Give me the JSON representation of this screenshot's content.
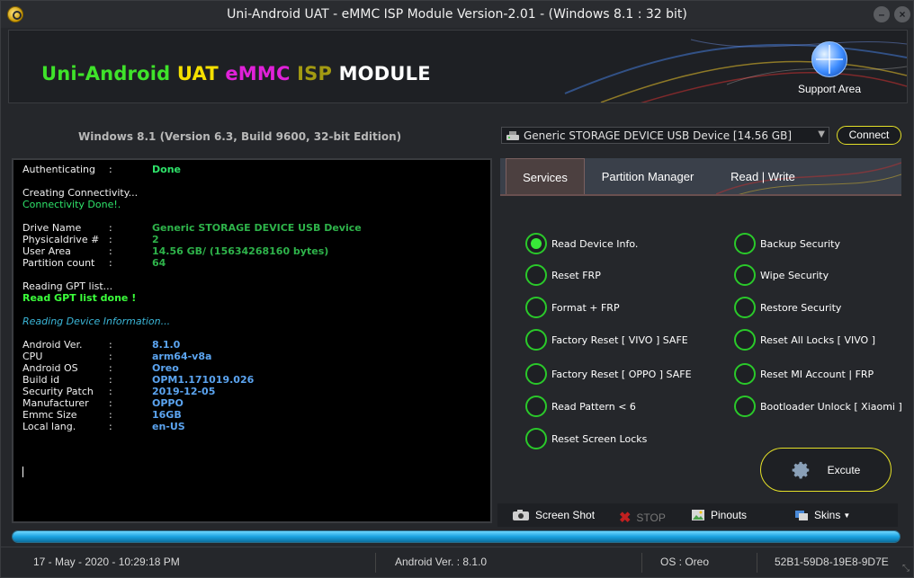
{
  "window": {
    "title": "Uni-Android UAT - eMMC ISP Module Version-2.01  -  (Windows 8.1  : 32 bit)"
  },
  "banner": {
    "brand_parts": [
      "Uni-Android ",
      "UAT ",
      "eMMC ",
      "ISP ",
      "MODULE"
    ],
    "brand_colors": [
      "#3fe32a",
      "#f5e000",
      "#e021d8",
      "#a39a12",
      "#ffffff"
    ],
    "support_label": "Support Area",
    "support_icon": "globe-icon"
  },
  "os_info": "Windows 8.1 (Version 6.3, Build 9600, 32-bit Edition)",
  "device": {
    "selected": "Generic STORAGE DEVICE USB Device  [14.56 GB]",
    "connect_label": "Connect"
  },
  "console": {
    "auth_key": "Authenticating",
    "auth_sep": ":",
    "auth_val": "Done",
    "creating": "Creating Connectivity...",
    "conn_done": "Connectivity Done!.",
    "drive_rows": [
      {
        "k": "Drive Name",
        "s": ":",
        "v": "Generic STORAGE DEVICE USB Device"
      },
      {
        "k": "Physicaldrive #",
        "s": ":",
        "v": "2"
      },
      {
        "k": "User Area",
        "s": ":",
        "v": "14.56 GB/ (15634268160 bytes)"
      },
      {
        "k": "Partition count",
        "s": ":",
        "v": "64"
      }
    ],
    "reading_gpt": "Reading GPT list...",
    "gpt_done": "Read GPT list done !",
    "reading_info": "Reading Device Information...",
    "info_rows": [
      {
        "k": "Android Ver.",
        "s": ":",
        "v": "8.1.0"
      },
      {
        "k": "CPU",
        "s": ":",
        "v": "arm64-v8a"
      },
      {
        "k": "Android OS",
        "s": ":",
        "v": "Oreo"
      },
      {
        "k": "Build id",
        "s": ":",
        "v": "OPM1.171019.026"
      },
      {
        "k": "Security Patch",
        "s": ":",
        "v": "2019-12-05"
      },
      {
        "k": "Manufacturer",
        "s": ":",
        "v": "OPPO"
      },
      {
        "k": "Emmc Size",
        "s": ":",
        "v": "16GB"
      },
      {
        "k": "Local lang.",
        "s": ":",
        "v": "en-US"
      }
    ]
  },
  "tabs": [
    "Services",
    "Partition Manager",
    "Read | Write"
  ],
  "services": {
    "left": [
      "Read Device Info.",
      "Reset FRP",
      "Format + FRP",
      "Factory Reset [ VIVO ] SAFE",
      "Factory Reset [ OPPO ] SAFE",
      "Read Pattern  < 6",
      "Reset Screen Locks"
    ],
    "right": [
      "Backup Security",
      "Wipe Security",
      "Restore Security",
      "Reset All Locks [ VIVO ]",
      "Reset MI Account | FRP",
      "Bootloader Unlock [ Xiaomi ]"
    ],
    "selected": "Read Device Info."
  },
  "excute_label": "Excute",
  "toolbar": {
    "screenshot": "Screen Shot",
    "stop": "STOP",
    "pinouts": "Pinouts",
    "skins": "Skins"
  },
  "progress": 1.0,
  "status": {
    "datetime": "17 - May - 2020  -  10:29:18 PM",
    "android_ver": "Android Ver. : 8.1.0",
    "os": "OS : Oreo",
    "id": "52B1-59D8-19E8-9D7E"
  }
}
